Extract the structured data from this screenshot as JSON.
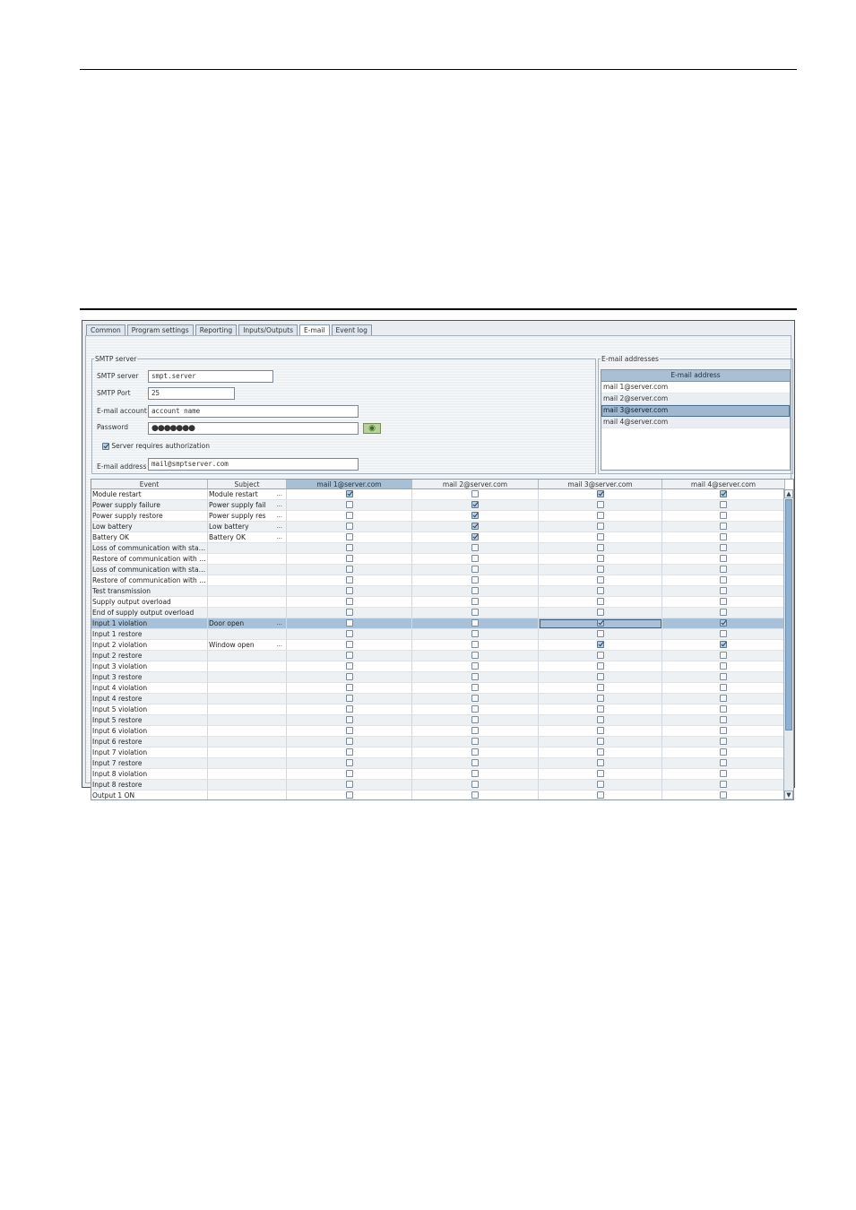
{
  "tabs": [
    "Common",
    "Program settings",
    "Reporting",
    "Inputs/Outputs",
    "E-mail",
    "Event log"
  ],
  "active_tab": "E-mail",
  "smtp": {
    "group_label": "SMTP server",
    "server_label": "SMTP server",
    "server_value": "smpt.server",
    "port_label": "SMTP Port",
    "port_value": "25",
    "account_label": "E-mail account",
    "account_value": "account name",
    "password_label": "Password",
    "password_value": "●●●●●●●",
    "auth_label": "Server requires authorization",
    "auth_checked": true,
    "address_label": "E-mail address",
    "address_value": "mail@smptserver.com"
  },
  "addresses": {
    "group_label": "E-mail addresses",
    "column_header": "E-mail address",
    "items": [
      "mail 1@server.com",
      "mail 2@server.com",
      "mail 3@server.com",
      "mail 4@server.com"
    ],
    "selected_index": 2
  },
  "grid": {
    "headers": [
      "Event",
      "Subject",
      "mail 1@server.com",
      "mail 2@server.com",
      "mail 3@server.com",
      "mail 4@server.com"
    ],
    "sorted_column": 2,
    "selected_row": 12,
    "focused_cell": [
      12,
      2
    ],
    "rows": [
      {
        "event": "Module restart",
        "subject": "Module restart",
        "dots": true,
        "checks": [
          true,
          false,
          true,
          true
        ]
      },
      {
        "event": "Power supply failure",
        "subject": "Power supply fail",
        "dots": true,
        "checks": [
          false,
          true,
          false,
          false
        ]
      },
      {
        "event": "Power supply restore",
        "subject": "Power supply res",
        "dots": true,
        "checks": [
          false,
          true,
          false,
          false
        ]
      },
      {
        "event": "Low battery",
        "subject": "Low battery",
        "dots": true,
        "checks": [
          false,
          true,
          false,
          false
        ]
      },
      {
        "event": "Battery OK",
        "subject": "Battery OK",
        "dots": true,
        "checks": [
          false,
          true,
          false,
          false
        ]
      },
      {
        "event": "Loss of communication with stat...",
        "subject": "",
        "dots": false,
        "checks": [
          false,
          false,
          false,
          false
        ]
      },
      {
        "event": "Restore of communication with s...",
        "subject": "",
        "dots": false,
        "checks": [
          false,
          false,
          false,
          false
        ]
      },
      {
        "event": "Loss of communication with stat...",
        "subject": "",
        "dots": false,
        "checks": [
          false,
          false,
          false,
          false
        ]
      },
      {
        "event": "Restore of communication with s...",
        "subject": "",
        "dots": false,
        "checks": [
          false,
          false,
          false,
          false
        ]
      },
      {
        "event": "Test transmission",
        "subject": "",
        "dots": false,
        "checks": [
          false,
          false,
          false,
          false
        ]
      },
      {
        "event": "Supply output overload",
        "subject": "",
        "dots": false,
        "checks": [
          false,
          false,
          false,
          false
        ]
      },
      {
        "event": "End of supply output overload",
        "subject": "",
        "dots": false,
        "checks": [
          false,
          false,
          false,
          false
        ]
      },
      {
        "event": "Input 1 violation",
        "subject": "Door open",
        "dots": true,
        "checks": [
          false,
          false,
          true,
          true
        ]
      },
      {
        "event": "Input 1 restore",
        "subject": "",
        "dots": false,
        "checks": [
          false,
          false,
          false,
          false
        ]
      },
      {
        "event": "Input 2 violation",
        "subject": "Window open",
        "dots": true,
        "checks": [
          false,
          false,
          true,
          true
        ]
      },
      {
        "event": "Input 2 restore",
        "subject": "",
        "dots": false,
        "checks": [
          false,
          false,
          false,
          false
        ]
      },
      {
        "event": "Input 3 violation",
        "subject": "",
        "dots": false,
        "checks": [
          false,
          false,
          false,
          false
        ]
      },
      {
        "event": "Input 3 restore",
        "subject": "",
        "dots": false,
        "checks": [
          false,
          false,
          false,
          false
        ]
      },
      {
        "event": "Input 4 violation",
        "subject": "",
        "dots": false,
        "checks": [
          false,
          false,
          false,
          false
        ]
      },
      {
        "event": "Input 4 restore",
        "subject": "",
        "dots": false,
        "checks": [
          false,
          false,
          false,
          false
        ]
      },
      {
        "event": "Input 5 violation",
        "subject": "",
        "dots": false,
        "checks": [
          false,
          false,
          false,
          false
        ]
      },
      {
        "event": "Input 5 restore",
        "subject": "",
        "dots": false,
        "checks": [
          false,
          false,
          false,
          false
        ]
      },
      {
        "event": "Input 6 violation",
        "subject": "",
        "dots": false,
        "checks": [
          false,
          false,
          false,
          false
        ]
      },
      {
        "event": "Input 6 restore",
        "subject": "",
        "dots": false,
        "checks": [
          false,
          false,
          false,
          false
        ]
      },
      {
        "event": "Input 7 violation",
        "subject": "",
        "dots": false,
        "checks": [
          false,
          false,
          false,
          false
        ]
      },
      {
        "event": "Input 7 restore",
        "subject": "",
        "dots": false,
        "checks": [
          false,
          false,
          false,
          false
        ]
      },
      {
        "event": "Input 8 violation",
        "subject": "",
        "dots": false,
        "checks": [
          false,
          false,
          false,
          false
        ]
      },
      {
        "event": "Input 8 restore",
        "subject": "",
        "dots": false,
        "checks": [
          false,
          false,
          false,
          false
        ]
      },
      {
        "event": "Output 1 ON",
        "subject": "",
        "dots": false,
        "checks": [
          false,
          false,
          false,
          false
        ]
      }
    ]
  },
  "colors": {
    "selection": "#a9c1d8",
    "header_sorted": "#a9bfd4",
    "scroll_thumb": "#8fb1cf"
  }
}
